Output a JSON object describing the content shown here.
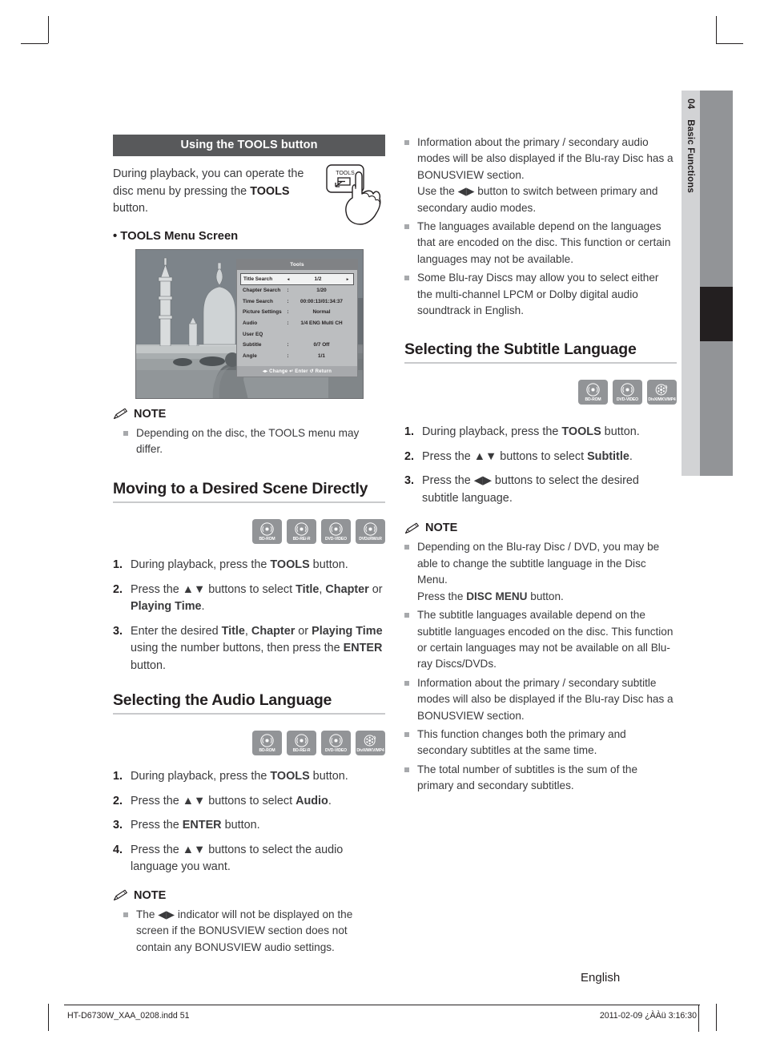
{
  "side_tab": {
    "number": "04",
    "label": "Basic Functions"
  },
  "left_column": {
    "section_bar_title": "Using the TOOLS button",
    "intro_pre": "During playback, you can operate the disc menu by pressing the ",
    "intro_bold": "TOOLS",
    "intro_post": " button.",
    "bullet_pre": "• ",
    "bullet_bold": "TOOLS",
    "bullet_post": " Menu Screen",
    "tools_button_label": "TOOLS",
    "osd": {
      "title": "Tools",
      "footer": "◂▸ Change   ↵ Enter   ↺ Return",
      "rows": [
        {
          "key": "Title Search",
          "sep": "",
          "value": "1/2",
          "selected": true
        },
        {
          "key": "Chapter Search",
          "sep": ":",
          "value": "1/20",
          "selected": false
        },
        {
          "key": "Time Search",
          "sep": ":",
          "value": "00:00:13/01:34:37",
          "selected": false
        },
        {
          "key": "Picture Settings",
          "sep": ":",
          "value": "Normal",
          "selected": false
        },
        {
          "key": "Audio",
          "sep": ":",
          "value": "1/4 ENG Multi CH",
          "selected": false
        },
        {
          "key": "User EQ",
          "sep": "",
          "value": "",
          "selected": false
        },
        {
          "key": "Subtitle",
          "sep": ":",
          "value": "0/7 Off",
          "selected": false
        },
        {
          "key": "Angle",
          "sep": ":",
          "value": "1/1",
          "selected": false
        }
      ]
    },
    "note1": {
      "label": "NOTE",
      "items": [
        "Depending on the disc, the TOOLS menu may differ."
      ]
    },
    "scene_heading": "Moving to a Desired Scene Directly",
    "scene_discs": [
      "BD-ROM",
      "BD-RE/-R",
      "DVD-VIDEO",
      "DVD±RW/±R"
    ],
    "scene_steps": [
      {
        "num": "1.",
        "html": "During playback, press the <b>TOOLS</b> button."
      },
      {
        "num": "2.",
        "html": "Press the ▲▼ buttons to select <b>Title</b>, <b>Chapter</b> or <b>Playing Time</b>."
      },
      {
        "num": "3.",
        "html": "Enter the desired <b>Title</b>, <b>Chapter</b> or <b>Playing Time</b> using the number buttons, then press the <b>ENTER</b> button."
      }
    ],
    "audio_heading": "Selecting the Audio Language",
    "audio_discs": [
      "BD-ROM",
      "BD-RE/-R",
      "DVD-VIDEO",
      "DivX/MKV/MP4"
    ],
    "audio_steps": [
      {
        "num": "1.",
        "html": "During playback, press the <b>TOOLS</b> button."
      },
      {
        "num": "2.",
        "html": "Press the ▲▼ buttons to select <b>Audio</b>."
      },
      {
        "num": "3.",
        "html": "Press the <b>ENTER</b> button."
      },
      {
        "num": "4.",
        "html": "Press the ▲▼ buttons to select the audio language you want."
      }
    ],
    "note2": {
      "label": "NOTE",
      "items": [
        "The ◀▶ indicator will not be displayed on the screen if the BONUSVIEW section does not contain any BONUSVIEW audio settings."
      ]
    }
  },
  "right_column": {
    "top_notes": [
      "Information about the primary / secondary audio modes will be also displayed if the Blu-ray Disc has a BONUSVIEW section.\nUse the ◀▶ button to switch between primary and secondary audio modes.",
      "The languages available depend on the languages that are encoded on the disc. This function or certain languages may not be available.",
      "Some Blu-ray Discs may allow you to select either the multi-channel LPCM or Dolby digital audio soundtrack in English."
    ],
    "subtitle_heading": "Selecting the Subtitle Language",
    "subtitle_discs": [
      "BD-ROM",
      "DVD-VIDEO",
      "DivX/MKV/MP4"
    ],
    "subtitle_steps": [
      {
        "num": "1.",
        "html": "During playback, press the <b>TOOLS</b> button."
      },
      {
        "num": "2.",
        "html": "Press the ▲▼ buttons to select <b>Subtitle</b>."
      },
      {
        "num": "3.",
        "html": "Press the ◀▶ buttons to select the desired subtitle language."
      }
    ],
    "note": {
      "label": "NOTE",
      "items_html": [
        "Depending on the Blu-ray Disc / DVD, you may be able to change the subtitle language in the Disc Menu.<br>Press the <b>DISC MENU</b> button.",
        "The subtitle languages available depend on the subtitle languages encoded on the disc. This function or certain languages may not be available on all Blu-ray Discs/DVDs.",
        "Information about the primary / secondary subtitle modes will also be displayed if the Blu-ray Disc has a BONUSVIEW section.",
        "This function changes both the primary and secondary subtitles at the same time.",
        "The total number of subtitles is the sum of the primary and secondary subtitles."
      ]
    }
  },
  "footer": {
    "language": "English",
    "file": "HT-D6730W_XAA_0208.indd   51",
    "timestamp": "2011-02-09   ¿ÀÀü 3:16:30"
  }
}
